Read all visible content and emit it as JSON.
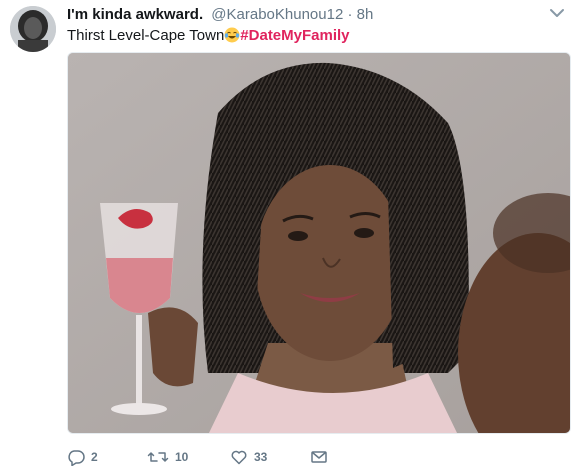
{
  "tweet": {
    "display_name": "I'm kinda awkward.",
    "handle": "@KaraboKhunou12",
    "separator": "·",
    "time": "8h",
    "text_prefix": "Thirst Level-Cape Town",
    "emoji": "face-with-tears-of-joy",
    "hashtag": "#DateMyFamily"
  },
  "actions": {
    "reply_count": "2",
    "retweet_count": "10",
    "like_count": "33"
  },
  "icons": {
    "more": "chevron-down-icon",
    "reply": "reply-icon",
    "retweet": "retweet-icon",
    "like": "heart-icon",
    "message": "envelope-icon"
  },
  "colors": {
    "hashtag": "#e0245e",
    "muted": "#657786",
    "text": "#14171a"
  }
}
